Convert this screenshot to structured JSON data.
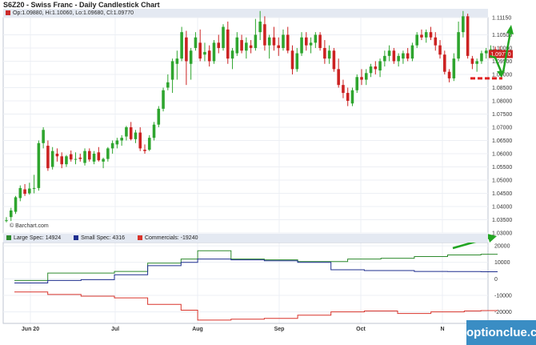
{
  "header": {
    "title": "S6Z20 - Swiss Franc - Daily Candlestick Chart",
    "ohlc_text": "Op:1.09880, Hi:1.10060, Lo:1.09680, Cl:1.09770",
    "source": "© Barchart.com",
    "last_price_label": "1.09770"
  },
  "watermark": "optionclue.com",
  "colors": {
    "up": "#2ea52e",
    "down": "#cc2222",
    "large_spec": "#2e8b2e",
    "small_spec": "#1f2f8f",
    "commercials": "#d9342b",
    "arrow": "#22a522",
    "support": "#e02020",
    "last_price_box": "#cc2222"
  },
  "chart_data": [
    {
      "type": "candlestick",
      "title": "S6Z20 - Swiss Franc - Daily Candlestick Chart",
      "x_labels": [
        "Jun 20",
        "Jul",
        "Aug",
        "Sep",
        "Oct",
        "N"
      ],
      "y_ticks": [
        "1.11150",
        "1.10500",
        "1.10000",
        "1.09500",
        "1.09000",
        "1.08500",
        "1.08000",
        "1.07500",
        "1.07000",
        "1.06500",
        "1.06000",
        "1.05500",
        "1.05000",
        "1.04500",
        "1.04000",
        "1.03500",
        "1.03000"
      ],
      "ylim": [
        1.03,
        1.1115
      ],
      "candles": [
        {
          "o": 1.0345,
          "h": 1.036,
          "l": 1.034,
          "c": 1.0348
        },
        {
          "o": 1.036,
          "h": 1.0395,
          "l": 1.0345,
          "c": 1.0385
        },
        {
          "o": 1.038,
          "h": 1.044,
          "l": 1.0372,
          "c": 1.0435
        },
        {
          "o": 1.0432,
          "h": 1.048,
          "l": 1.042,
          "c": 1.047
        },
        {
          "o": 1.0465,
          "h": 1.0485,
          "l": 1.044,
          "c": 1.0448
        },
        {
          "o": 1.045,
          "h": 1.049,
          "l": 1.0445,
          "c": 1.0468
        },
        {
          "o": 1.047,
          "h": 1.052,
          "l": 1.045,
          "c": 1.047
        },
        {
          "o": 1.047,
          "h": 1.065,
          "l": 1.046,
          "c": 1.064
        },
        {
          "o": 1.064,
          "h": 1.07,
          "l": 1.062,
          "c": 1.069
        },
        {
          "o": 1.063,
          "h": 1.065,
          "l": 1.0535,
          "c": 1.0545
        },
        {
          "o": 1.055,
          "h": 1.0625,
          "l": 1.054,
          "c": 1.061
        },
        {
          "o": 1.06,
          "h": 1.062,
          "l": 1.057,
          "c": 1.059
        },
        {
          "o": 1.059,
          "h": 1.0605,
          "l": 1.0545,
          "c": 1.056
        },
        {
          "o": 1.056,
          "h": 1.0595,
          "l": 1.055,
          "c": 1.059
        },
        {
          "o": 1.0598,
          "h": 1.0612,
          "l": 1.057,
          "c": 1.0578
        },
        {
          "o": 1.058,
          "h": 1.0605,
          "l": 1.056,
          "c": 1.058
        },
        {
          "o": 1.0585,
          "h": 1.06,
          "l": 1.057,
          "c": 1.058
        },
        {
          "o": 1.0565,
          "h": 1.062,
          "l": 1.0555,
          "c": 1.061
        },
        {
          "o": 1.061,
          "h": 1.062,
          "l": 1.057,
          "c": 1.0578
        },
        {
          "o": 1.057,
          "h": 1.061,
          "l": 1.056,
          "c": 1.06
        },
        {
          "o": 1.0605,
          "h": 1.0625,
          "l": 1.057,
          "c": 1.0575
        },
        {
          "o": 1.057,
          "h": 1.0585,
          "l": 1.0545,
          "c": 1.058
        },
        {
          "o": 1.058,
          "h": 1.0625,
          "l": 1.057,
          "c": 1.062
        },
        {
          "o": 1.062,
          "h": 1.065,
          "l": 1.06,
          "c": 1.064
        },
        {
          "o": 1.0635,
          "h": 1.066,
          "l": 1.062,
          "c": 1.065
        },
        {
          "o": 1.065,
          "h": 1.067,
          "l": 1.063,
          "c": 1.066
        },
        {
          "o": 1.0665,
          "h": 1.0705,
          "l": 1.065,
          "c": 1.07
        },
        {
          "o": 1.07,
          "h": 1.072,
          "l": 1.065,
          "c": 1.0655
        },
        {
          "o": 1.0655,
          "h": 1.069,
          "l": 1.064,
          "c": 1.068
        },
        {
          "o": 1.068,
          "h": 1.07,
          "l": 1.061,
          "c": 1.062
        },
        {
          "o": 1.0615,
          "h": 1.0635,
          "l": 1.06,
          "c": 1.061
        },
        {
          "o": 1.0615,
          "h": 1.067,
          "l": 1.061,
          "c": 1.066
        },
        {
          "o": 1.066,
          "h": 1.072,
          "l": 1.065,
          "c": 1.071
        },
        {
          "o": 1.071,
          "h": 1.078,
          "l": 1.07,
          "c": 1.077
        },
        {
          "o": 1.077,
          "h": 1.085,
          "l": 1.076,
          "c": 1.084
        },
        {
          "o": 1.085,
          "h": 1.09,
          "l": 1.084,
          "c": 1.087
        },
        {
          "o": 1.088,
          "h": 1.096,
          "l": 1.083,
          "c": 1.095
        },
        {
          "o": 1.094,
          "h": 1.099,
          "l": 1.088,
          "c": 1.096
        },
        {
          "o": 1.096,
          "h": 1.108,
          "l": 1.095,
          "c": 1.106
        },
        {
          "o": 1.104,
          "h": 1.1065,
          "l": 1.086,
          "c": 1.095
        },
        {
          "o": 1.094,
          "h": 1.1,
          "l": 1.088,
          "c": 1.099
        },
        {
          "o": 1.1,
          "h": 1.106,
          "l": 1.099,
          "c": 1.104
        },
        {
          "o": 1.102,
          "h": 1.107,
          "l": 1.095,
          "c": 1.096
        },
        {
          "o": 1.0975,
          "h": 1.102,
          "l": 1.095,
          "c": 1.0985
        },
        {
          "o": 1.099,
          "h": 1.101,
          "l": 1.093,
          "c": 1.095
        },
        {
          "o": 1.095,
          "h": 1.103,
          "l": 1.094,
          "c": 1.102
        },
        {
          "o": 1.102,
          "h": 1.105,
          "l": 1.098,
          "c": 1.1
        },
        {
          "o": 1.1,
          "h": 1.109,
          "l": 1.099,
          "c": 1.108
        },
        {
          "o": 1.107,
          "h": 1.11,
          "l": 1.094,
          "c": 1.096
        },
        {
          "o": 1.096,
          "h": 1.1,
          "l": 1.092,
          "c": 1.099
        },
        {
          "o": 1.098,
          "h": 1.106,
          "l": 1.097,
          "c": 1.104
        },
        {
          "o": 1.103,
          "h": 1.105,
          "l": 1.098,
          "c": 1.099
        },
        {
          "o": 1.099,
          "h": 1.104,
          "l": 1.096,
          "c": 1.102
        },
        {
          "o": 1.101,
          "h": 1.103,
          "l": 1.098,
          "c": 1.1
        },
        {
          "o": 1.1,
          "h": 1.111,
          "l": 1.099,
          "c": 1.105
        },
        {
          "o": 1.106,
          "h": 1.114,
          "l": 1.103,
          "c": 1.11
        },
        {
          "o": 1.109,
          "h": 1.112,
          "l": 1.099,
          "c": 1.101
        },
        {
          "o": 1.101,
          "h": 1.105,
          "l": 1.096,
          "c": 1.104
        },
        {
          "o": 1.104,
          "h": 1.108,
          "l": 1.099,
          "c": 1.101
        },
        {
          "o": 1.101,
          "h": 1.104,
          "l": 1.097,
          "c": 1.1
        },
        {
          "o": 1.1,
          "h": 1.107,
          "l": 1.099,
          "c": 1.105
        },
        {
          "o": 1.105,
          "h": 1.108,
          "l": 1.098,
          "c": 1.099
        },
        {
          "o": 1.099,
          "h": 1.101,
          "l": 1.09,
          "c": 1.092
        },
        {
          "o": 1.092,
          "h": 1.1,
          "l": 1.091,
          "c": 1.098
        },
        {
          "o": 1.098,
          "h": 1.106,
          "l": 1.097,
          "c": 1.104
        },
        {
          "o": 1.104,
          "h": 1.106,
          "l": 1.099,
          "c": 1.101
        },
        {
          "o": 1.101,
          "h": 1.104,
          "l": 1.098,
          "c": 1.102
        },
        {
          "o": 1.102,
          "h": 1.106,
          "l": 1.1,
          "c": 1.105
        },
        {
          "o": 1.105,
          "h": 1.106,
          "l": 1.099,
          "c": 1.1
        },
        {
          "o": 1.1,
          "h": 1.103,
          "l": 1.094,
          "c": 1.096
        },
        {
          "o": 1.096,
          "h": 1.101,
          "l": 1.094,
          "c": 1.099
        },
        {
          "o": 1.099,
          "h": 1.1,
          "l": 1.091,
          "c": 1.092
        },
        {
          "o": 1.092,
          "h": 1.096,
          "l": 1.085,
          "c": 1.086
        },
        {
          "o": 1.086,
          "h": 1.088,
          "l": 1.081,
          "c": 1.083
        },
        {
          "o": 1.083,
          "h": 1.085,
          "l": 1.078,
          "c": 1.08
        },
        {
          "o": 1.079,
          "h": 1.085,
          "l": 1.078,
          "c": 1.084
        },
        {
          "o": 1.084,
          "h": 1.09,
          "l": 1.083,
          "c": 1.089
        },
        {
          "o": 1.089,
          "h": 1.092,
          "l": 1.086,
          "c": 1.088
        },
        {
          "o": 1.088,
          "h": 1.092,
          "l": 1.086,
          "c": 1.0905
        },
        {
          "o": 1.0905,
          "h": 1.094,
          "l": 1.089,
          "c": 1.093
        },
        {
          "o": 1.093,
          "h": 1.095,
          "l": 1.09,
          "c": 1.092
        },
        {
          "o": 1.0915,
          "h": 1.096,
          "l": 1.089,
          "c": 1.095
        },
        {
          "o": 1.095,
          "h": 1.099,
          "l": 1.093,
          "c": 1.097
        },
        {
          "o": 1.097,
          "h": 1.101,
          "l": 1.095,
          "c": 1.099
        },
        {
          "o": 1.099,
          "h": 1.1,
          "l": 1.094,
          "c": 1.095
        },
        {
          "o": 1.095,
          "h": 1.098,
          "l": 1.093,
          "c": 1.097
        },
        {
          "o": 1.096,
          "h": 1.099,
          "l": 1.094,
          "c": 1.098
        },
        {
          "o": 1.098,
          "h": 1.1,
          "l": 1.095,
          "c": 1.096
        },
        {
          "o": 1.096,
          "h": 1.102,
          "l": 1.095,
          "c": 1.101
        },
        {
          "o": 1.101,
          "h": 1.106,
          "l": 1.1,
          "c": 1.105
        },
        {
          "o": 1.105,
          "h": 1.107,
          "l": 1.103,
          "c": 1.104
        },
        {
          "o": 1.104,
          "h": 1.107,
          "l": 1.102,
          "c": 1.106
        },
        {
          "o": 1.106,
          "h": 1.108,
          "l": 1.103,
          "c": 1.104
        },
        {
          "o": 1.104,
          "h": 1.106,
          "l": 1.099,
          "c": 1.101
        },
        {
          "o": 1.101,
          "h": 1.103,
          "l": 1.096,
          "c": 1.0975
        },
        {
          "o": 1.0975,
          "h": 1.099,
          "l": 1.09,
          "c": 1.091
        },
        {
          "o": 1.091,
          "h": 1.092,
          "l": 1.087,
          "c": 1.0885
        },
        {
          "o": 1.0885,
          "h": 1.098,
          "l": 1.0875,
          "c": 1.096
        },
        {
          "o": 1.096,
          "h": 1.11,
          "l": 1.095,
          "c": 1.106
        },
        {
          "o": 1.106,
          "h": 1.114,
          "l": 1.104,
          "c": 1.112
        },
        {
          "o": 1.112,
          "h": 1.113,
          "l": 1.096,
          "c": 1.097
        },
        {
          "o": 1.096,
          "h": 1.097,
          "l": 1.092,
          "c": 1.094
        },
        {
          "o": 1.094,
          "h": 1.096,
          "l": 1.091,
          "c": 1.095
        },
        {
          "o": 1.095,
          "h": 1.099,
          "l": 1.094,
          "c": 1.098
        },
        {
          "o": 1.098,
          "h": 1.1,
          "l": 1.096,
          "c": 1.099
        },
        {
          "o": 1.099,
          "h": 1.101,
          "l": 1.097,
          "c": 1.0995
        },
        {
          "o": 1.0995,
          "h": 1.1005,
          "l": 1.0975,
          "c": 1.0985
        },
        {
          "o": 1.0988,
          "h": 1.1006,
          "l": 1.0968,
          "c": 1.0977
        }
      ]
    },
    {
      "type": "line",
      "title": "COT positions",
      "y_ticks": [
        "20000",
        "10000",
        "0",
        "-10000",
        "-20000"
      ],
      "ylim": [
        -27000,
        22000
      ],
      "series": [
        {
          "name": "Large Spec: 14924",
          "values": [
            -1000,
            -1000,
            3500,
            3500,
            3500,
            3500,
            4500,
            4500,
            9500,
            9500,
            12000,
            17000,
            17000,
            12000,
            12000,
            11500,
            11500,
            10500,
            10500,
            10500,
            12000,
            12000,
            12500,
            12500,
            13500,
            13500,
            14500,
            14500,
            14924
          ]
        },
        {
          "name": "Small Spec: 4316",
          "values": [
            -2500,
            -2500,
            -1000,
            -1000,
            -500,
            -500,
            2500,
            2500,
            8000,
            8000,
            10000,
            12000,
            12000,
            11500,
            11500,
            11000,
            11000,
            10000,
            10000,
            5500,
            5500,
            5000,
            5000,
            5000,
            4500,
            4500,
            4400,
            4400,
            4316
          ]
        },
        {
          "name": "Commercials: -19240",
          "values": [
            -8000,
            -8000,
            -9500,
            -9500,
            -10500,
            -10500,
            -11500,
            -11500,
            -15500,
            -15500,
            -19000,
            -25000,
            -25000,
            -24500,
            -24500,
            -24000,
            -24000,
            -22000,
            -22000,
            -20000,
            -20000,
            -19500,
            -19500,
            -21000,
            -21000,
            -20000,
            -20000,
            -19500,
            -19240
          ]
        }
      ]
    }
  ]
}
